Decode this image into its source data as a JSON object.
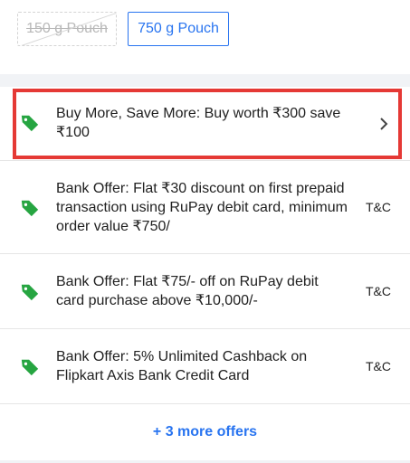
{
  "variants": {
    "disabled_label": "150 g Pouch",
    "selected_label": "750 g Pouch"
  },
  "offers": [
    {
      "text": "Buy More, Save More: Buy worth ₹300 save ₹100",
      "action": "chevron",
      "tc": ""
    },
    {
      "text": "Bank Offer: Flat ₹30 discount on first prepaid transaction using RuPay debit card, minimum order value ₹750/",
      "tc": "T&C"
    },
    {
      "text": "Bank Offer: Flat ₹75/- off on RuPay debit card purchase above ₹10,000/-",
      "tc": "T&C"
    },
    {
      "text": "Bank Offer: 5% Unlimited Cashback on Flipkart Axis Bank Credit Card",
      "tc": "T&C"
    }
  ],
  "more_offers_label": "+ 3 more offers",
  "colors": {
    "accent": "#2874f0",
    "tag": "#26a541",
    "highlight": "#e53935"
  }
}
